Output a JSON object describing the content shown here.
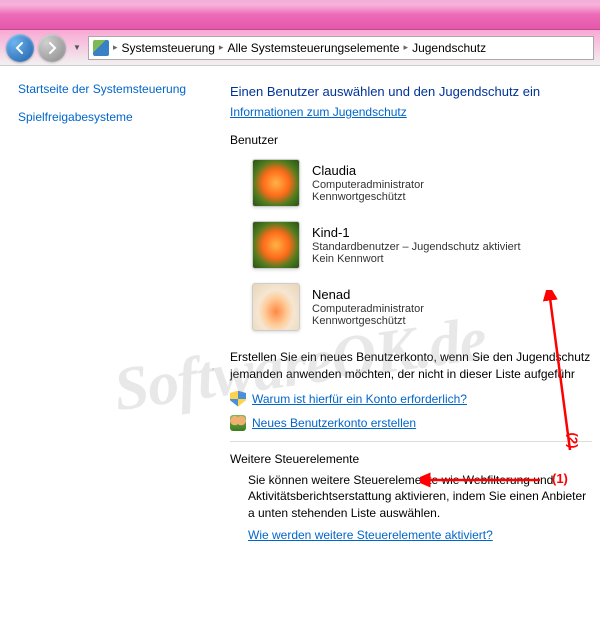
{
  "breadcrumb": {
    "seg1": "Systemsteuerung",
    "seg2": "Alle Systemsteuerungselemente",
    "seg3": "Jugendschutz"
  },
  "sidebar": {
    "home": "Startseite der Systemsteuerung",
    "games": "Spielfreigabesysteme"
  },
  "main": {
    "title": "Einen Benutzer auswählen und den Jugendschutz ein",
    "info_link": "Informationen zum Jugendschutz",
    "users_label": "Benutzer",
    "users": [
      {
        "name": "Claudia",
        "role": "Computeradministrator",
        "pw": "Kennwortgeschützt"
      },
      {
        "name": "Kind-1",
        "role": "Standardbenutzer – Jugendschutz aktiviert",
        "pw": "Kein Kennwort"
      },
      {
        "name": "Nenad",
        "role": "Computeradministrator",
        "pw": "Kennwortgeschützt"
      }
    ],
    "create_text": "Erstellen Sie ein neues Benutzerkonto, wenn Sie den Jugendschutz jemanden anwenden möchten, der nicht in dieser Liste aufgeführ",
    "why_link": "Warum ist hierfür ein Konto erforderlich?",
    "new_account_link": "Neues Benutzerkonto erstellen",
    "more_heading": "Weitere Steuerelemente",
    "more_text": "Sie können weitere Steuerelemente wie Webfilterung und Aktivitätsberichtserstattung aktivieren, indem Sie einen Anbieter a unten stehenden Liste auswählen.",
    "how_link": "Wie werden weitere Steuerelemente aktiviert?"
  },
  "annotations": {
    "a1": "(1)",
    "a2": "(2)"
  },
  "watermark": "SoftwareOK.de"
}
